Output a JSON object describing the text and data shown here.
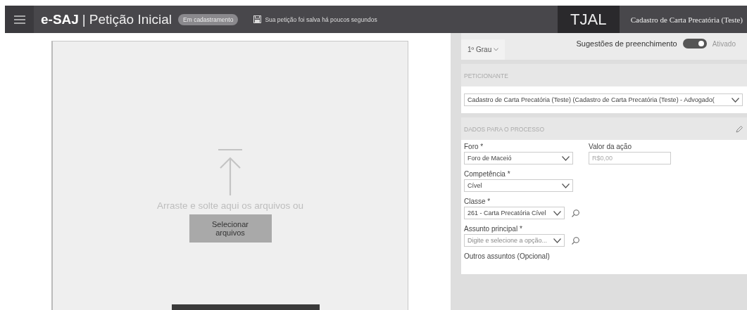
{
  "header": {
    "brand": "e-SAJ",
    "separator": "|",
    "title": "Petição Inicial",
    "status_badge": "Em cadastramento",
    "save_status": "Sua petição foi salva há poucos segundos",
    "court": "TJAL",
    "user": "Cadastro de Carta Precatória (Teste)"
  },
  "upload": {
    "instruction": "Arraste e solte aqui os arquivos ou",
    "button": "Selecionar arquivos"
  },
  "form": {
    "degree": "1º Grau",
    "suggestions": {
      "label": "Sugestões de preenchimento",
      "on": true,
      "state_text": "Ativado"
    },
    "petitioner": {
      "title": "PETICIONANTE",
      "value": "Cadastro de Carta Precatória (Teste) (Cadastro de Carta Precatória (Teste) - Advogado("
    },
    "process": {
      "title": "DADOS PARA O PROCESSO",
      "rows": [
        {
          "fields": [
            {
              "kind": "select",
              "label": "Foro *",
              "value": "Foro de Maceió"
            },
            {
              "kind": "input",
              "label": "Valor da ação",
              "placeholder": "R$0,00"
            }
          ]
        },
        {
          "fields": [
            {
              "kind": "select",
              "label": "Competência *",
              "value": "Cível"
            }
          ]
        },
        {
          "fields": [
            {
              "kind": "search-select",
              "label": "Classe *",
              "value": "261 - Carta Precatória Cível"
            }
          ]
        },
        {
          "fields": [
            {
              "kind": "search-select",
              "label": "Assunto principal *",
              "placeholder": "Digite e selecione a opção..."
            }
          ]
        },
        {
          "fields": [
            {
              "kind": "label",
              "label": "Outros assuntos (Opcional)"
            }
          ]
        }
      ]
    }
  }
}
